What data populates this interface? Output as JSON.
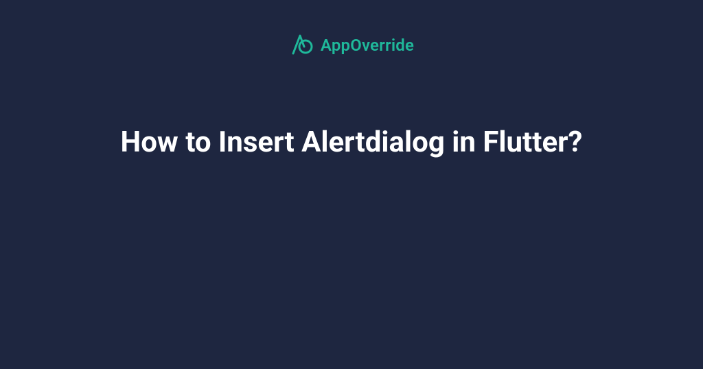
{
  "brand": {
    "name": "AppOverride",
    "accent_color": "#1fb89a"
  },
  "page": {
    "background_color": "#1e2640",
    "headline": "How to Insert Alertdialog in Flutter?"
  }
}
